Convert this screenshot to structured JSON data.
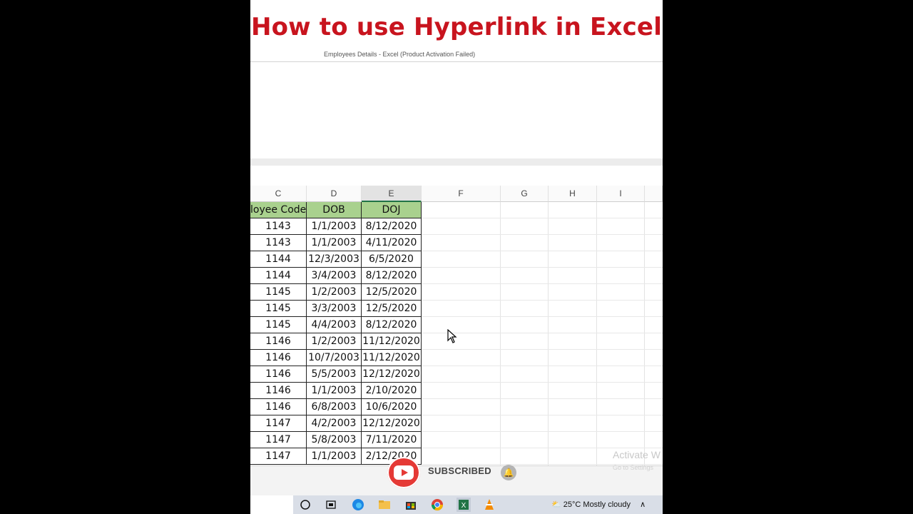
{
  "video_title": "How to use Hyperlink in Excel",
  "window_title": "Employees Details - Excel (Product Activation Failed)",
  "columns": [
    "C",
    "D",
    "E",
    "F",
    "G",
    "H",
    "I"
  ],
  "selected_column": "E",
  "table": {
    "headers": [
      "loyee Code",
      "DOB",
      "DOJ"
    ],
    "rows": [
      [
        "1143",
        "1/1/2003",
        "8/12/2020"
      ],
      [
        "1143",
        "1/1/2003",
        "4/11/2020"
      ],
      [
        "1144",
        "12/3/2003",
        "6/5/2020"
      ],
      [
        "1144",
        "3/4/2003",
        "8/12/2020"
      ],
      [
        "1145",
        "1/2/2003",
        "12/5/2020"
      ],
      [
        "1145",
        "3/3/2003",
        "12/5/2020"
      ],
      [
        "1145",
        "4/4/2003",
        "8/12/2020"
      ],
      [
        "1146",
        "1/2/2003",
        "11/12/2020"
      ],
      [
        "1146",
        "10/7/2003",
        "11/12/2020"
      ],
      [
        "1146",
        "5/5/2003",
        "12/12/2020"
      ],
      [
        "1146",
        "1/1/2003",
        "2/10/2020"
      ],
      [
        "1146",
        "6/8/2003",
        "10/6/2020"
      ],
      [
        "1147",
        "4/2/2003",
        "12/12/2020"
      ],
      [
        "1147",
        "5/8/2003",
        "7/11/2020"
      ],
      [
        "1147",
        "1/1/2003",
        "2/12/2020"
      ]
    ]
  },
  "activate_windows": "Activate W",
  "activate_windows_sub": "Go to Settings",
  "subscribe_label": "SUBSCRIBED",
  "taskbar": {
    "icons": [
      "search-icon",
      "task-view-icon",
      "edge-icon",
      "file-explorer-icon",
      "store-icon",
      "chrome-icon",
      "excel-icon",
      "vlc-icon"
    ],
    "weather": "25°C  Mostly cloudy"
  },
  "colors": {
    "title_red": "#c8141e",
    "header_green": "#a9d18e",
    "excel_green": "#217346"
  }
}
